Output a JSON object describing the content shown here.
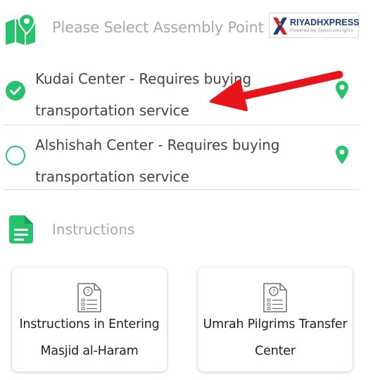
{
  "header": {
    "title": "Please Select Assembly Point",
    "logo": {
      "brand_part1": "RIYADH",
      "brand_part2": "XPRESS",
      "tagline": "Powered by SpectrumLights"
    }
  },
  "assembly_points": [
    {
      "label": "Kudai Center - Requires buying transportation service",
      "selected": true
    },
    {
      "label": "Alshishah Center - Requires buying transportation service",
      "selected": false
    }
  ],
  "instructions": {
    "title": "Instructions",
    "cards": [
      {
        "label": "Instructions in Entering Masjid al-Haram"
      },
      {
        "label": "Umrah Pilgrims Transfer Center"
      }
    ]
  },
  "colors": {
    "accent_green": "#27c26c",
    "annotation_arrow": "#e8141b",
    "muted_text": "#a9a9a9"
  },
  "icons": {
    "header": "map-location-icon",
    "selected_radio": "check-circle-icon",
    "unselected_radio": "radio-empty-icon",
    "location": "map-pin-icon",
    "instructions": "document-icon",
    "card": "question-checklist-icon"
  }
}
